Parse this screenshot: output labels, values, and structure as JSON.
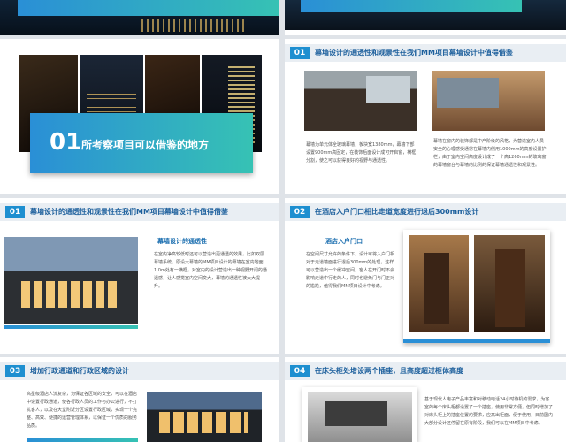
{
  "slides": {
    "cover": {
      "number": "01",
      "title": "所考察项目可以借鉴的地方"
    },
    "s1": {
      "number": "01",
      "title": "幕墙设计的通透性和观景性在我们MM项目幕墙设计中值得借鉴",
      "left_text": "幕墙为单元体全玻璃幕墙，板块宽1380mm，幕墙下部设置900mm高固定，在装饰后面设计成可开启窗，横框分割，使之可以获得良好的视野与通透性。",
      "right_text": "幕墙在窗内的装饰都是中产阶级的风格，为营造室内人员安全的心理感受通常在幕墙内侧用1000mm的高度设置护栏，由于室内空间高度设计成了一个高1260mm的玻璃窗的幕墙窗台与幕墙的比例的保证幕墙通透性和观景性。"
    },
    "s2": {
      "number": "01",
      "title": "幕墙设计的通透性和观景性在我们MM项目幕墙设计中值得借鉴",
      "subtitle": "幕墙设计的通透性",
      "text": "在室内净高较低时还可以营造出更通透的效果，比如双层幕墙系统。原设大幕墙的MM项目设计的幕墙在室内地面1.0m处有一横框，对室内的设计营造出一种视野开阔的通透感，让人感觉室内空间变大，幕墙的通透性被大大提升。"
    },
    "s3": {
      "number": "02",
      "title": "在酒店入户门口相比走道宽度进行退后300mm设计",
      "subtitle": "酒店入户门口",
      "text": "在空间尺寸允许的条件下，设计可将入户门相对于走道墙面进行退后300mm的处理，这样可以营造出一个缓冲空间，客人在开门时不会影响走道中行走的人，同时也避免门与门正对的尴尬，值得我们MM项目设计中考虑。"
    },
    "s4": {
      "number": "03",
      "title": "增加行政通道和行政区域的设计",
      "text": "高星级酒店人流复杂，为保证各区域的安全，可以在酒店中设置行政通道，使各行政人员的工作与办公进行，不打扰客人，以及在大堂附近分区设置行政区域，实现一个完整、高效、便捷的运营管理体系，以保证一个优质的服务品质。"
    },
    "s5": {
      "number": "04",
      "title": "在床头柜处增设两个插座，且高度超过柜体高度",
      "text": "基于现代人电子产品丰富和对移动电话24小时待机的需求，为客室的每个床头柜都设置了一个插座，使用非常方便，但同时增加了对床头柜上的插座位置的要求，应高出柜面，便于使用，目前国内大部分设计还停留在原有阶段，我们可以在MM项目中考虑。"
    }
  },
  "colors": {
    "accent": "#1e8fd0",
    "title_blue": "#1c5f9c",
    "gradient_start": "#2a8fd6",
    "gradient_end": "#36c2b4"
  }
}
